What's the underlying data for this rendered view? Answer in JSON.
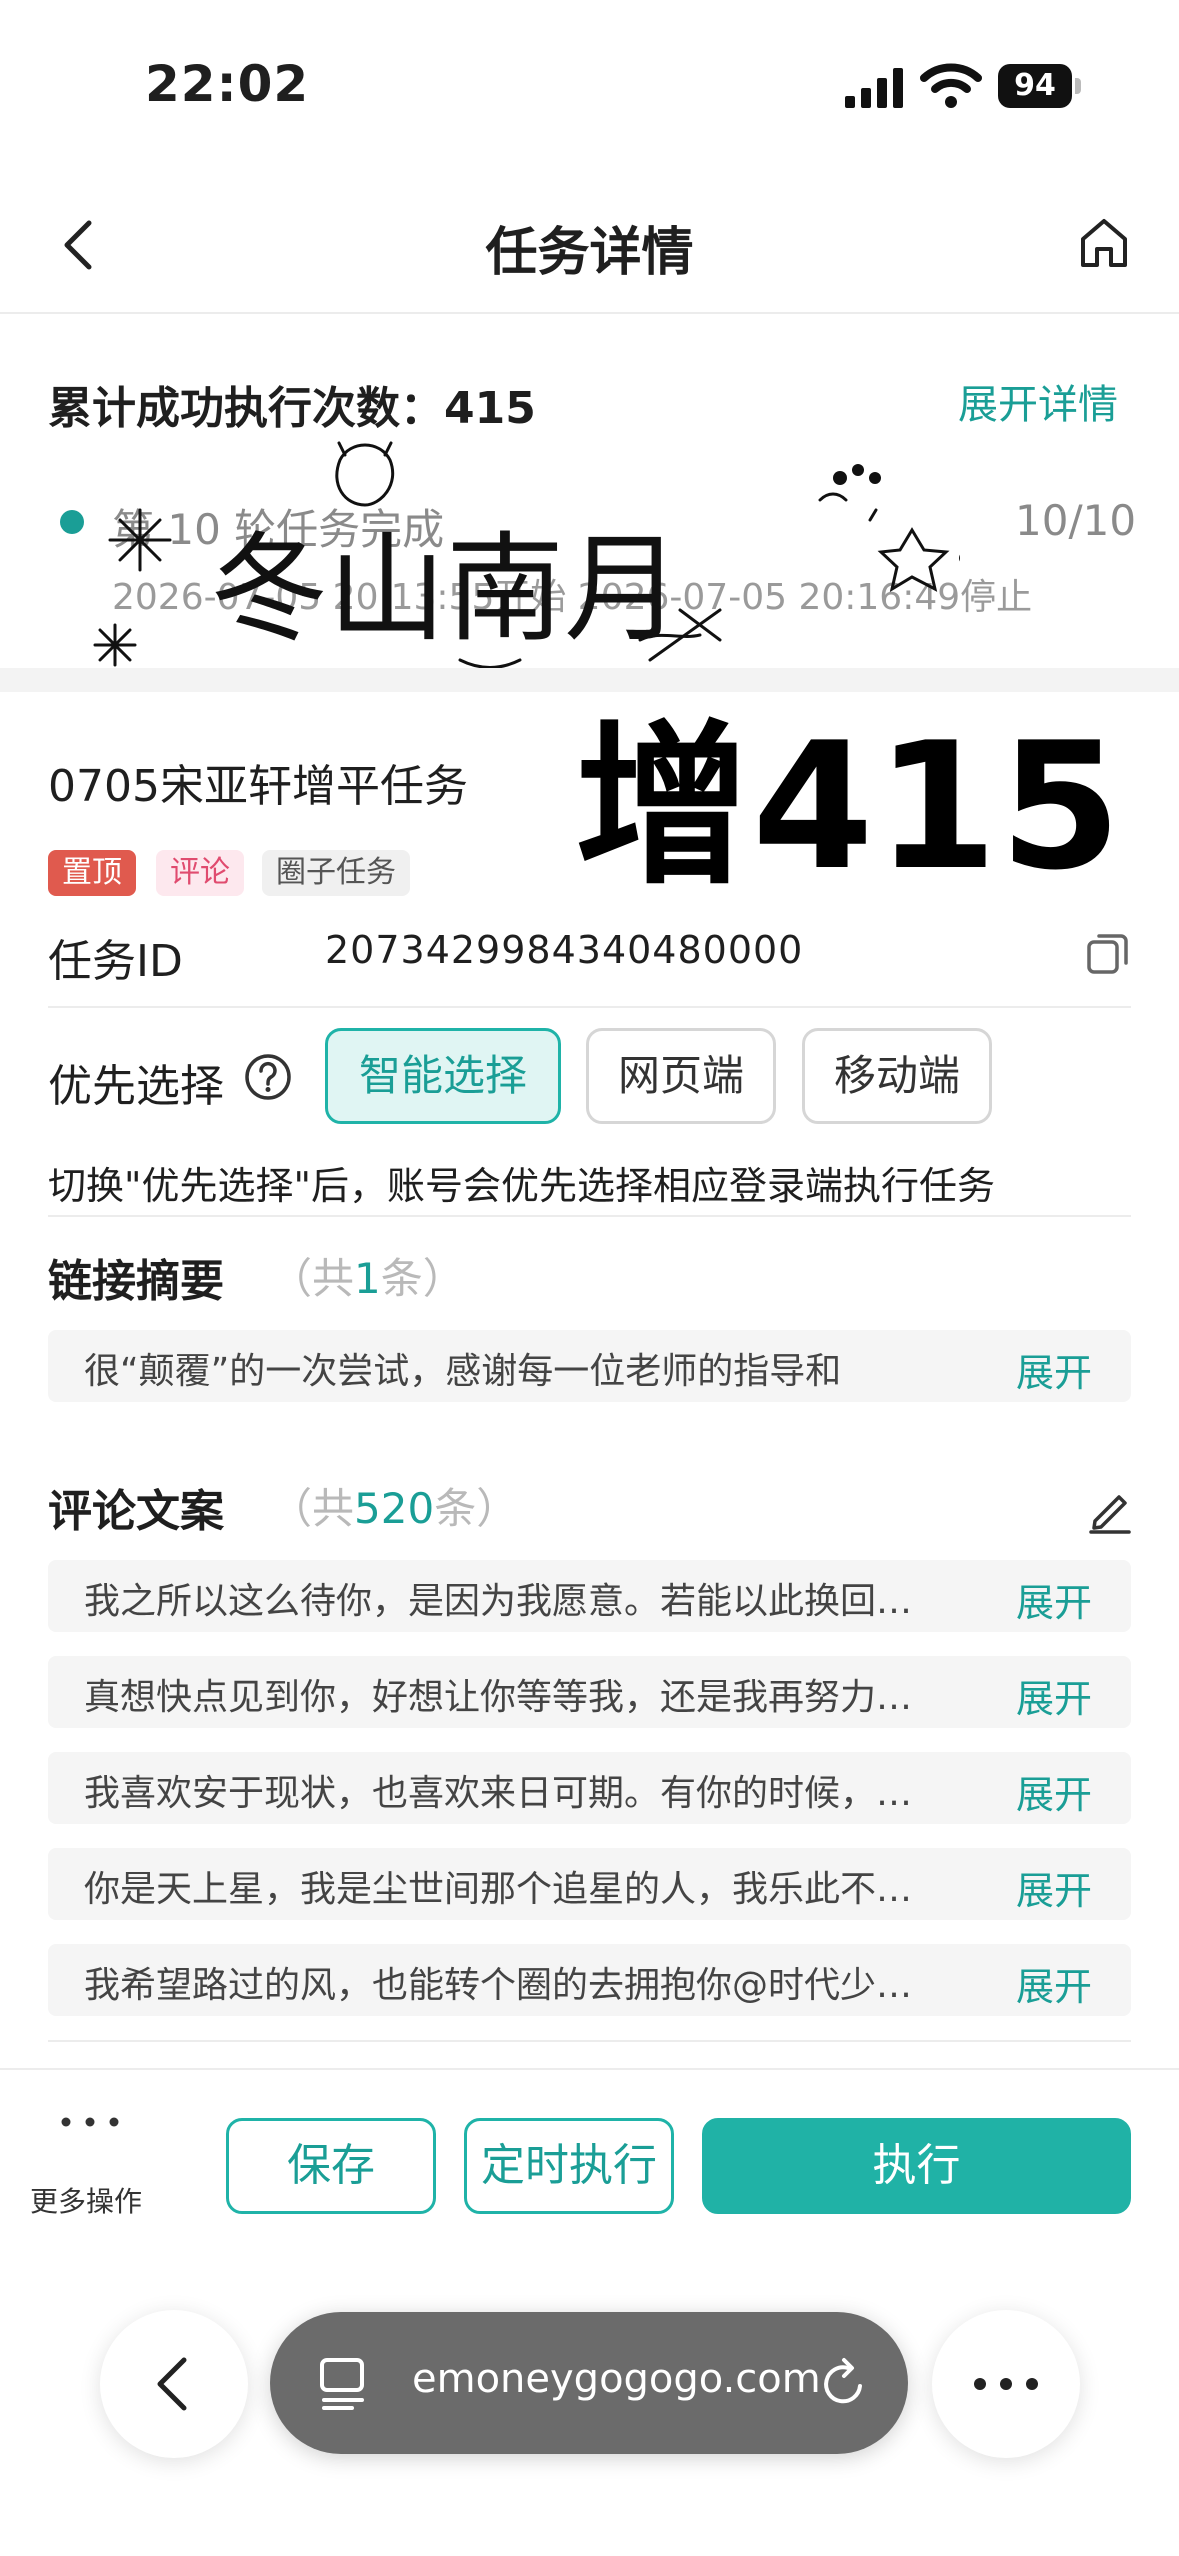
{
  "status": {
    "time": "22:02",
    "battery": "94"
  },
  "nav": {
    "title": "任务详情"
  },
  "summary": {
    "label": "累计成功执行次数：415",
    "expand": "展开详情",
    "round_text": "第 10 轮任务完成",
    "round_count": "10/10",
    "round_time": "2026-07-05 20:13:55开始 2026-07-05 20:16:49停止"
  },
  "watermark": {
    "text": "冬山南月",
    "overlay": "增415"
  },
  "task": {
    "name": "0705宋亚轩增平任务",
    "tags": [
      "置顶",
      "评论",
      "圈子任务"
    ],
    "id_label": "任务ID",
    "id_value": "2073429984340480000"
  },
  "preference": {
    "label": "优先选择",
    "options": [
      "智能选择",
      "网页端",
      "移动端"
    ],
    "selected": "智能选择",
    "hint": "切换\"优先选择\"后，账号会优先选择相应登录端执行任务"
  },
  "links": {
    "title": "链接摘要",
    "count_prefix": "（共",
    "count": "1",
    "count_suffix": "条）",
    "items": [
      {
        "text": "很“颠覆”的一次尝试，感谢每一位老师的指导和",
        "action": "展开"
      }
    ]
  },
  "comments": {
    "title": "评论文案",
    "count_prefix": "（共",
    "count": "520",
    "count_suffix": "条）",
    "items": [
      {
        "text": "我之所以这么待你，是因为我愿意。若能以此换回…",
        "action": "展开"
      },
      {
        "text": "真想快点见到你，好想让你等等我，还是我再努力…",
        "action": "展开"
      },
      {
        "text": "我喜欢安于现状，也喜欢来日可期。有你的时候，…",
        "action": "展开"
      },
      {
        "text": "你是天上星，我是尘世间那个追星的人，我乐此不…",
        "action": "展开"
      },
      {
        "text": "我希望路过的风，也能转个圈的去拥抱你@时代少…",
        "action": "展开"
      }
    ]
  },
  "bottom": {
    "more_label": "更多操作",
    "save": "保存",
    "schedule": "定时执行",
    "execute": "执行"
  },
  "browser": {
    "url": "emoneygogogo.com"
  },
  "colors": {
    "accent": "#1a9e96",
    "accent_button": "#20b2a6",
    "tag_top": "#e05a4e",
    "tag_comment": "#e04b6f"
  }
}
